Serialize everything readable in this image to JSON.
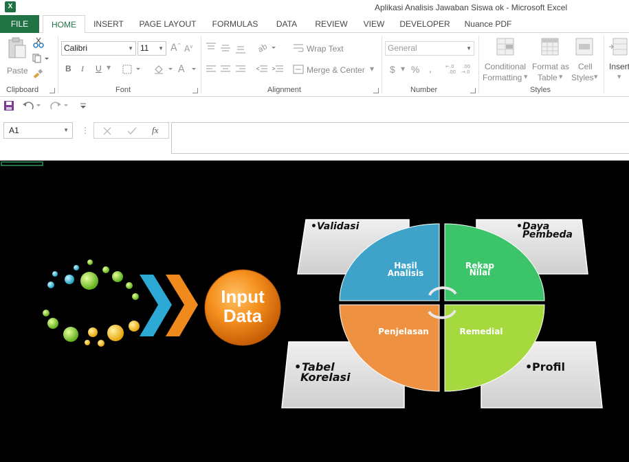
{
  "window": {
    "title": "Aplikasi Analisis Jawaban Siswa ok - Microsoft Excel",
    "app_icon_letter": "X"
  },
  "tabs": [
    {
      "label": "FILE"
    },
    {
      "label": "HOME"
    },
    {
      "label": "INSERT"
    },
    {
      "label": "PAGE LAYOUT"
    },
    {
      "label": "FORMULAS"
    },
    {
      "label": "DATA"
    },
    {
      "label": "REVIEW"
    },
    {
      "label": "VIEW"
    },
    {
      "label": "DEVELOPER"
    },
    {
      "label": "Nuance PDF"
    }
  ],
  "ribbon": {
    "clipboard": {
      "paste": "Paste",
      "group": "Clipboard"
    },
    "font": {
      "name": "Calibri",
      "size": "11",
      "group": "Font",
      "bold": "B",
      "italic": "I",
      "underline": "U"
    },
    "alignment": {
      "wrap_text": "Wrap Text",
      "merge_center": "Merge & Center",
      "group": "Alignment"
    },
    "number": {
      "format": "General",
      "currency": "$",
      "percent": "%",
      "comma": ",",
      "group": "Number"
    },
    "styles": {
      "conditional_1": "Conditional",
      "conditional_2": "Formatting",
      "format_table_1": "Format as",
      "format_table_2": "Table",
      "cell_styles_1": "Cell",
      "cell_styles_2": "Styles",
      "group": "Styles"
    },
    "cells": {
      "insert": "Insert"
    }
  },
  "formula_bar": {
    "name_box": "A1",
    "fx": "fx",
    "value": ""
  },
  "diagram": {
    "input_line1": "Input",
    "input_line2": "Data",
    "hub": {
      "hasil_1": "Hasil",
      "hasil_2": "Analisis",
      "rekap_1": "Rekap",
      "rekap_2": "Nilai",
      "penjelasan": "Penjelasan",
      "remedial": "Remedial"
    },
    "cards": {
      "validasi": "Validasi",
      "daya_1": "Daya",
      "daya_2": "Pembeda",
      "tabel_1": "Tabel",
      "tabel_2": "Korelasi",
      "profil": "Profil"
    },
    "colors": {
      "blue": "#3ea2c9",
      "green": "#3cc46a",
      "orange": "#ee9141",
      "lime": "#a5d93d",
      "input_orange": "#f08a1c",
      "card": "#d9d9d9"
    }
  }
}
